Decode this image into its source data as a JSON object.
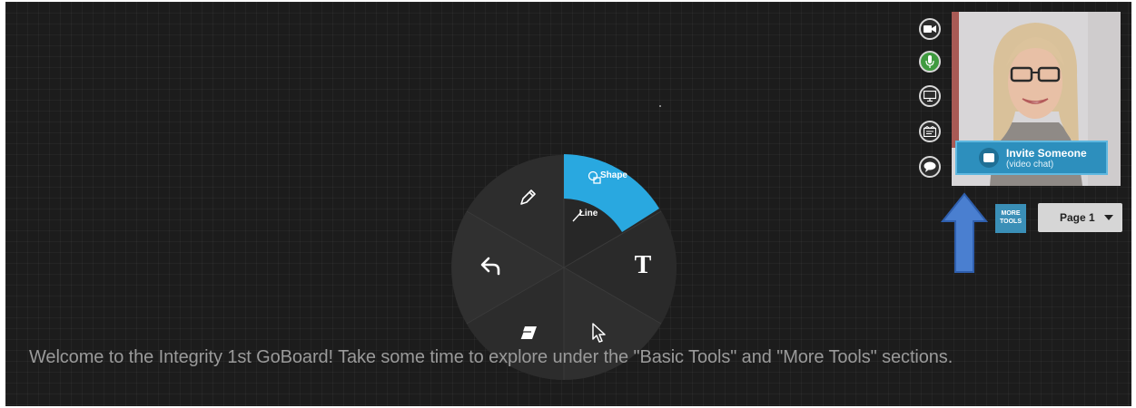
{
  "welcome_text": "Welcome to the Integrity 1st GoBoard!  Take some time to explore under the \"Basic Tools\" and \"More Tools\" sections.",
  "radial_menu": {
    "shape_label": "Shape",
    "line_label": "Line",
    "text_tool_glyph": "T",
    "icons": [
      "pencil-icon",
      "undo-icon",
      "text-icon",
      "eraser-icon",
      "pointer-icon",
      "shapes-icon",
      "line-icon"
    ]
  },
  "video": {
    "invite_title": "Invite Someone",
    "invite_subtitle": "(video chat)"
  },
  "media_buttons": [
    "camera-icon",
    "microphone-icon",
    "screen-share-icon",
    "media-icon",
    "chat-icon"
  ],
  "toolbar": {
    "more_tools_label": "MORE TOOLS",
    "page_selected": "Page 1"
  },
  "colors": {
    "board": "#1c1c1c",
    "accent": "#29a8e0",
    "mic_active": "#3f9a3f",
    "arrow": "#4a7fd0"
  }
}
